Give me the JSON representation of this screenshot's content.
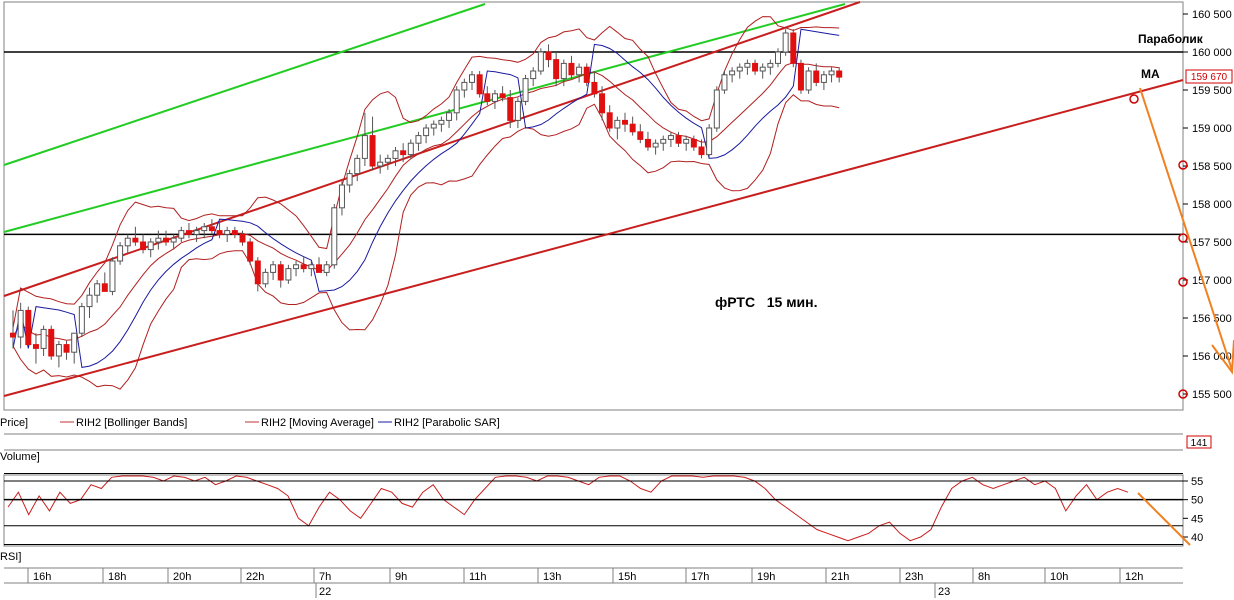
{
  "chart_data": {
    "type": "candlestick",
    "title": "фРТС   15 мин.",
    "price_axis": {
      "ticks": [
        "160 500",
        "160 000",
        "159 500",
        "159 000",
        "158 500",
        "158 000",
        "157 500",
        "157 000",
        "156 500",
        "156 000",
        "155 500"
      ],
      "tick_values": [
        160500,
        160000,
        159500,
        159000,
        158500,
        158000,
        157500,
        157000,
        156500,
        156000,
        155500
      ],
      "last_price_label": "159 670",
      "last_price": 159670
    },
    "time_axis": {
      "ticks": [
        "16h",
        "18h",
        "20h",
        "22h",
        "7h",
        "9h",
        "11h",
        "13h",
        "15h",
        "17h",
        "19h",
        "21h",
        "23h",
        "8h",
        "10h",
        "12h"
      ],
      "dates": [
        "22",
        "23"
      ]
    },
    "annotations": {
      "parabolic": "Параболик",
      "ma": "MA"
    },
    "legend": {
      "price": "Price]",
      "bollinger": "RIH2 [Bollinger Bands]",
      "ma": "RIH2 [Moving Average]",
      "sar": "RIH2 [Parabolic SAR]"
    },
    "horizontal_levels": [
      160000,
      157600
    ],
    "volume": {
      "label": "Volume]",
      "value_label": "141"
    },
    "rsi": {
      "label": "RSI]",
      "ticks": [
        "55",
        "50",
        "45",
        "40"
      ],
      "tick_values": [
        55,
        50,
        45,
        40
      ],
      "levels": [
        57,
        55,
        50,
        43,
        38
      ],
      "values": [
        48,
        52,
        46,
        51,
        47,
        52,
        49,
        50,
        54,
        53,
        56,
        58,
        59,
        57,
        56,
        55,
        57,
        56,
        55,
        56,
        54,
        55,
        57,
        56,
        55,
        54,
        53,
        51,
        45,
        43,
        48,
        52,
        50,
        47,
        45,
        49,
        53,
        52,
        49,
        48,
        52,
        54,
        50,
        48,
        46,
        50,
        53,
        56,
        58,
        57,
        56,
        55,
        58,
        57,
        56,
        55,
        54,
        56,
        58,
        57,
        55,
        53,
        52,
        55,
        58,
        59,
        57,
        56,
        57,
        58,
        57,
        56,
        55,
        53,
        50,
        48,
        46,
        44,
        42,
        41,
        40,
        39,
        40,
        41,
        43,
        44,
        41,
        39,
        40,
        42,
        48,
        53,
        55,
        56,
        54,
        53,
        54,
        55,
        56,
        54,
        55,
        53,
        47,
        51,
        54,
        50,
        52,
        53,
        52
      ]
    },
    "candles": [
      [
        156300,
        156600,
        156100,
        156250
      ],
      [
        156250,
        156700,
        156100,
        156600
      ],
      [
        156600,
        156650,
        156150,
        156150
      ],
      [
        156150,
        156300,
        155900,
        156100
      ],
      [
        156100,
        156400,
        156000,
        156350
      ],
      [
        156350,
        156400,
        155950,
        156000
      ],
      [
        156000,
        156200,
        155850,
        156150
      ],
      [
        156150,
        156200,
        155950,
        156050
      ],
      [
        156050,
        156300,
        155900,
        156300
      ],
      [
        156300,
        156700,
        156250,
        156650
      ],
      [
        156650,
        156900,
        156500,
        156800
      ],
      [
        156800,
        157000,
        156700,
        156950
      ],
      [
        156950,
        157100,
        156850,
        156850
      ],
      [
        156850,
        157300,
        156800,
        157250
      ],
      [
        157250,
        157500,
        157200,
        157450
      ],
      [
        157450,
        157600,
        157350,
        157550
      ],
      [
        157550,
        157700,
        157450,
        157500
      ],
      [
        157500,
        157600,
        157350,
        157400
      ],
      [
        157400,
        157550,
        157300,
        157500
      ],
      [
        157500,
        157650,
        157400,
        157550
      ],
      [
        157550,
        157650,
        157450,
        157500
      ],
      [
        157500,
        157600,
        157400,
        157550
      ],
      [
        157550,
        157700,
        157500,
        157650
      ],
      [
        157650,
        157750,
        157550,
        157600
      ],
      [
        157600,
        157700,
        157500,
        157650
      ],
      [
        157650,
        157750,
        157550,
        157700
      ],
      [
        157700,
        157800,
        157600,
        157650
      ],
      [
        157650,
        157750,
        157550,
        157600
      ],
      [
        157600,
        157700,
        157500,
        157650
      ],
      [
        157650,
        157700,
        157550,
        157600
      ],
      [
        157600,
        157650,
        157450,
        157500
      ],
      [
        157500,
        157550,
        157200,
        157250
      ],
      [
        157250,
        157300,
        156850,
        156950
      ],
      [
        156950,
        157150,
        156900,
        157100
      ],
      [
        157100,
        157250,
        157000,
        157200
      ],
      [
        157200,
        157250,
        156900,
        157000
      ],
      [
        157000,
        157200,
        156950,
        157150
      ],
      [
        157150,
        157250,
        157050,
        157200
      ],
      [
        157200,
        157300,
        157100,
        157150
      ],
      [
        157150,
        157250,
        157050,
        157200
      ],
      [
        157200,
        157300,
        157100,
        157100
      ],
      [
        157100,
        157250,
        157050,
        157200
      ],
      [
        157200,
        158000,
        157150,
        157950
      ],
      [
        157950,
        158300,
        157850,
        158250
      ],
      [
        158250,
        158450,
        158150,
        158400
      ],
      [
        158400,
        158650,
        158300,
        158600
      ],
      [
        158600,
        159200,
        158500,
        158900
      ],
      [
        158900,
        159150,
        158450,
        158500
      ],
      [
        158500,
        158650,
        158400,
        158550
      ],
      [
        158550,
        158650,
        158450,
        158600
      ],
      [
        158600,
        158750,
        158500,
        158700
      ],
      [
        158700,
        158800,
        158550,
        158650
      ],
      [
        158650,
        158850,
        158600,
        158800
      ],
      [
        158800,
        158950,
        158700,
        158900
      ],
      [
        158900,
        159050,
        158800,
        159000
      ],
      [
        159000,
        159100,
        158900,
        159050
      ],
      [
        159050,
        159150,
        158950,
        159100
      ],
      [
        159100,
        159250,
        159000,
        159200
      ],
      [
        159200,
        159550,
        159100,
        159500
      ],
      [
        159500,
        159650,
        159400,
        159600
      ],
      [
        159600,
        159750,
        159500,
        159700
      ],
      [
        159700,
        159750,
        159400,
        159450
      ],
      [
        159450,
        159550,
        159300,
        159350
      ],
      [
        159350,
        159500,
        159250,
        159450
      ],
      [
        159450,
        159550,
        159350,
        159400
      ],
      [
        159400,
        159500,
        159000,
        159100
      ],
      [
        159100,
        159400,
        159000,
        159350
      ],
      [
        159350,
        159700,
        159300,
        159650
      ],
      [
        159650,
        159800,
        159550,
        159750
      ],
      [
        159750,
        160050,
        159700,
        160000
      ],
      [
        160000,
        160100,
        159800,
        159900
      ],
      [
        159900,
        160000,
        159550,
        159650
      ],
      [
        159650,
        159900,
        159550,
        159850
      ],
      [
        159850,
        159950,
        159650,
        159700
      ],
      [
        159700,
        159850,
        159600,
        159800
      ],
      [
        159800,
        159850,
        159550,
        159600
      ],
      [
        159600,
        159750,
        159400,
        159450
      ],
      [
        159450,
        159550,
        159100,
        159200
      ],
      [
        159200,
        159300,
        158950,
        159000
      ],
      [
        159000,
        159150,
        158850,
        159100
      ],
      [
        159100,
        159200,
        158950,
        159050
      ],
      [
        159050,
        159150,
        158900,
        158950
      ],
      [
        158950,
        159050,
        158800,
        158850
      ],
      [
        158850,
        158950,
        158700,
        158750
      ],
      [
        158750,
        158850,
        158650,
        158800
      ],
      [
        158800,
        158900,
        158700,
        158850
      ],
      [
        158850,
        158950,
        158750,
        158900
      ],
      [
        158900,
        158950,
        158750,
        158800
      ],
      [
        158800,
        158900,
        158700,
        158850
      ],
      [
        158850,
        158900,
        158700,
        158750
      ],
      [
        158750,
        158850,
        158600,
        158650
      ],
      [
        158650,
        159050,
        158600,
        159000
      ],
      [
        159000,
        159550,
        158950,
        159500
      ],
      [
        159500,
        159750,
        159450,
        159700
      ],
      [
        159700,
        159800,
        159600,
        159750
      ],
      [
        159750,
        159850,
        159650,
        159800
      ],
      [
        159800,
        159900,
        159700,
        159850
      ],
      [
        159850,
        159900,
        159700,
        159750
      ],
      [
        159750,
        159850,
        159650,
        159800
      ],
      [
        159800,
        159900,
        159700,
        159850
      ],
      [
        159850,
        160050,
        159800,
        160000
      ],
      [
        160000,
        160300,
        159950,
        160250
      ],
      [
        160250,
        160300,
        159800,
        159850
      ],
      [
        159850,
        159900,
        159450,
        159500
      ],
      [
        159500,
        159800,
        159450,
        159750
      ],
      [
        159750,
        159850,
        159550,
        159600
      ],
      [
        159600,
        159750,
        159500,
        159700
      ],
      [
        159700,
        159800,
        159600,
        159750
      ],
      [
        159750,
        159800,
        159600,
        159670
      ]
    ]
  }
}
